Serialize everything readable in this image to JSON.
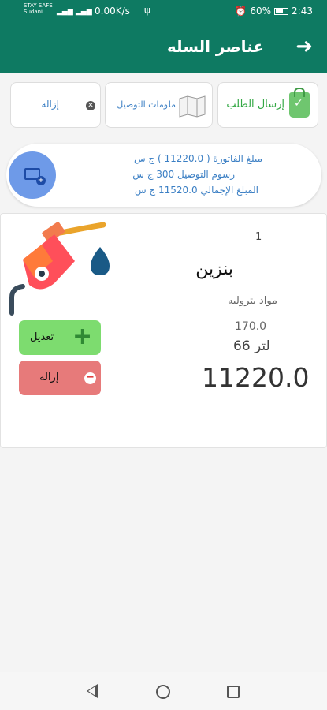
{
  "status_bar": {
    "carrier_line1": "STAY SAFE",
    "carrier_line2": "Sudani",
    "network_speed": "0.00K/s",
    "battery": "60%",
    "time": "2:43"
  },
  "app_bar": {
    "title": "عناصر السله",
    "back_icon": "arrow-right-icon"
  },
  "actions": {
    "send_order_label": "إرسال الطلب",
    "delivery_info_label": "ملومات التوصيل",
    "remove_label": "إزاله"
  },
  "summary": {
    "line1": "مبلغ الفاتورة  ( 11220.0 ) ج س",
    "line2": "رسوم التوصيل   300 ج س",
    "line3": "المبلغ الإجمالي 11520.0 ج س"
  },
  "item": {
    "number": "1",
    "name": "بنزين",
    "category": "مواد بتروليه",
    "unit_price": "170.0",
    "quantity": "66 لتر",
    "total": "11220.0",
    "edit_label": "تعديل",
    "remove_label": "إزاله",
    "image_icon": "fuel-pump-icon"
  },
  "colors": {
    "primary": "#0e7a62",
    "accent_blue": "#3b7fc4",
    "edit_green": "#7ddc6f",
    "remove_red": "#e77a7a"
  }
}
